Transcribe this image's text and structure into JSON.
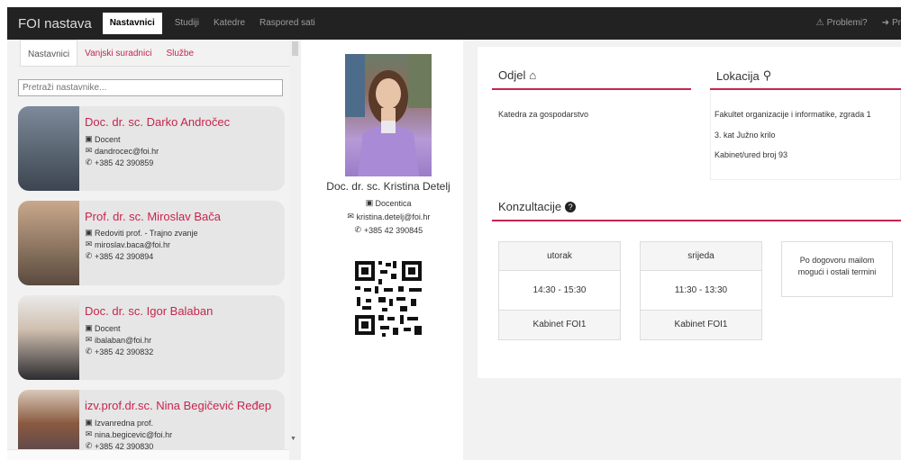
{
  "navbar": {
    "brand": "FOI nastava",
    "items": [
      {
        "label": "Nastavnici",
        "active": true
      },
      {
        "label": "Studiji",
        "active": false
      },
      {
        "label": "Katedre",
        "active": false
      },
      {
        "label": "Raspored sati",
        "active": false
      }
    ],
    "problems_label": "Problemi?",
    "login_label": "Pr"
  },
  "left": {
    "tabs": [
      "Nastavnici",
      "Vanjski suradnici",
      "Službe"
    ],
    "search_placeholder": "Pretraži nastavnike...",
    "teachers": [
      {
        "name": "Doc. dr. sc. Darko Andročec",
        "title": "Docent",
        "email": "dandrocec@foi.hr",
        "phone": "+385 42 390859"
      },
      {
        "name": "Prof. dr. sc. Miroslav Bača",
        "title": "Redoviti prof. - Trajno zvanje",
        "email": "miroslav.baca@foi.hr",
        "phone": "+385 42 390894"
      },
      {
        "name": "Doc. dr. sc. Igor Balaban",
        "title": "Docent",
        "email": "ibalaban@foi.hr",
        "phone": "+385 42 390832"
      },
      {
        "name": "izv.prof.dr.sc. Nina Begičević Ređep",
        "title": "Izvanredna prof.",
        "email": "nina.begicevic@foi.hr",
        "phone": "+385 42 390830"
      }
    ]
  },
  "profile": {
    "name": "Doc. dr. sc. Kristina Detelj",
    "title": "Docentica",
    "email": "kristina.detelj@foi.hr",
    "phone": "+385 42 390845"
  },
  "details": {
    "odjel_title": "Odjel",
    "odjel_value": "Katedra za gospodarstvo",
    "lokacija_title": "Lokacija",
    "lokacija_lines": [
      "Fakultet organizacije i informatike, zgrada 1",
      "3. kat Južno krilo",
      "Kabinet/ured broj 93"
    ],
    "konzultacije_title": "Konzultacije",
    "consultations": [
      {
        "day": "utorak",
        "time": "14:30 - 15:30",
        "room": "Kabinet FOI1"
      },
      {
        "day": "srijeda",
        "time": "11:30 - 13:30",
        "room": "Kabinet FOI1"
      }
    ],
    "note_line1": "Po dogovoru mailom",
    "note_line2": "mogući i ostali termini"
  },
  "colors": {
    "accent": "#c7254e",
    "navbar": "#222222"
  }
}
